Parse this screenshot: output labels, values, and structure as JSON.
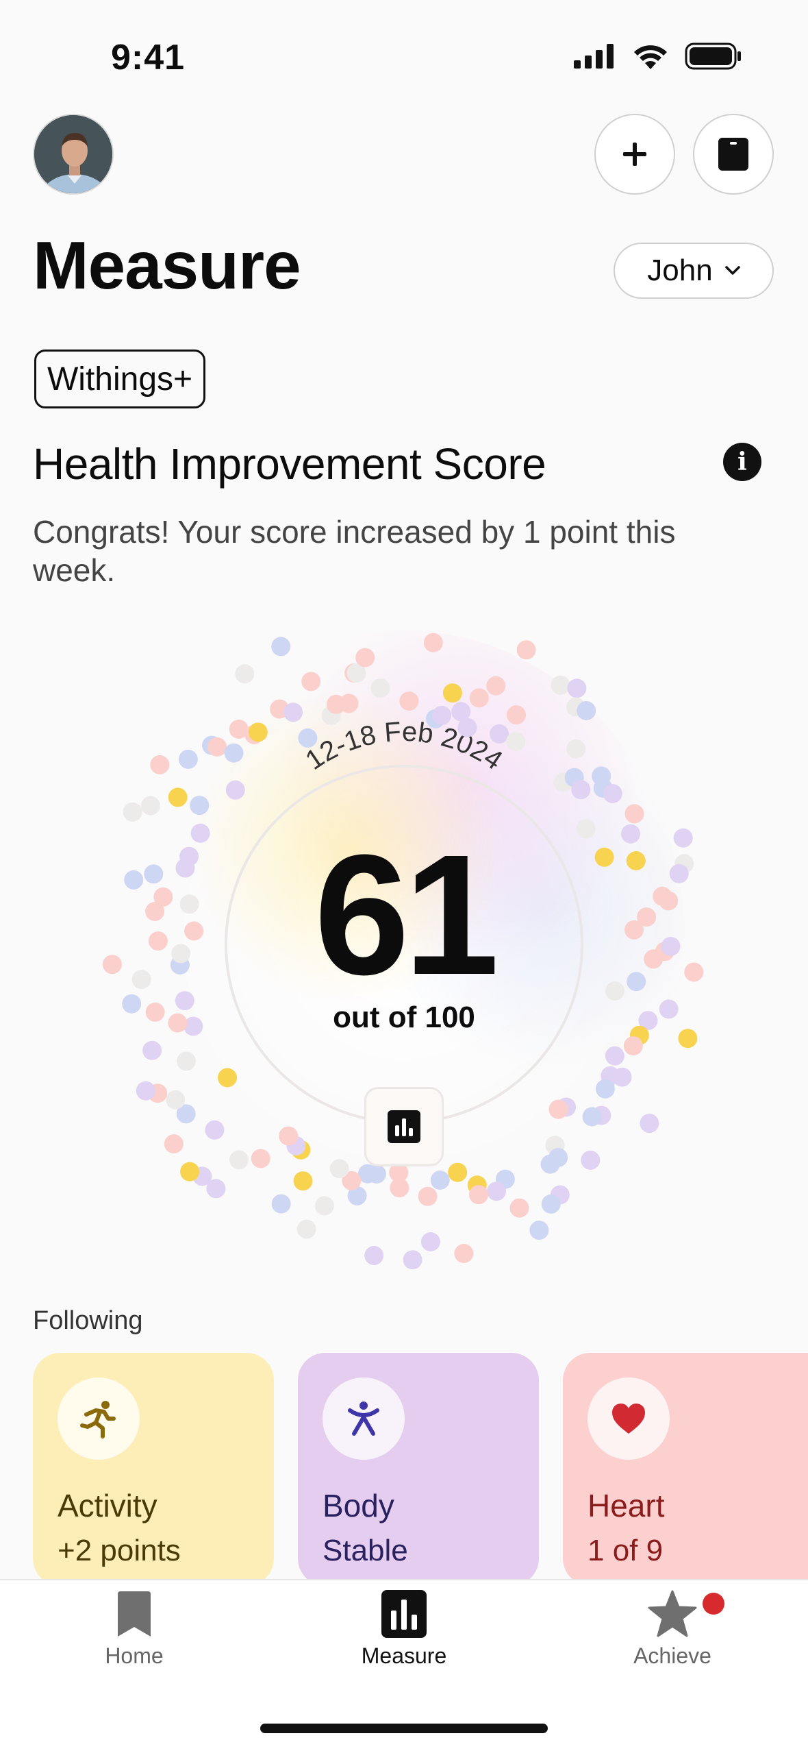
{
  "status_bar": {
    "time": "9:41"
  },
  "header": {
    "title": "Measure",
    "user_select": "John",
    "plan_badge": "Withings+"
  },
  "score_section": {
    "title": "Health Improvement Score",
    "description": "Congrats! Your score increased by 1 point this week.",
    "date_range": "12-18 Feb 2024",
    "score": "61",
    "out_of": "out of 100"
  },
  "following": {
    "label": "Following",
    "cards": [
      {
        "name": "Activity",
        "sub": "+2 points",
        "icon": "running-icon",
        "bg": "#fdeeb8",
        "fg": "#4a3a06"
      },
      {
        "name": "Body",
        "sub": "Stable",
        "icon": "body-icon",
        "bg": "#e4cdee",
        "fg": "#2a2260"
      },
      {
        "name": "Heart",
        "sub": "1 of 9",
        "icon": "heart-icon",
        "bg": "#fbd0cf",
        "fg": "#8c1c1c"
      }
    ]
  },
  "tabs": [
    {
      "label": "Home",
      "icon": "bookmark-icon",
      "active": false
    },
    {
      "label": "Measure",
      "icon": "bar-chart-icon",
      "active": true
    },
    {
      "label": "Achieve",
      "icon": "star-icon",
      "active": false
    }
  ],
  "colors": {
    "dot_yellow": "#f7d34f",
    "dot_pink": "#fbcfcb",
    "dot_lavender": "#e0d2f2",
    "dot_blue": "#cdd6f3",
    "dot_grey": "#ecebe9",
    "notification": "#d62a2f"
  }
}
